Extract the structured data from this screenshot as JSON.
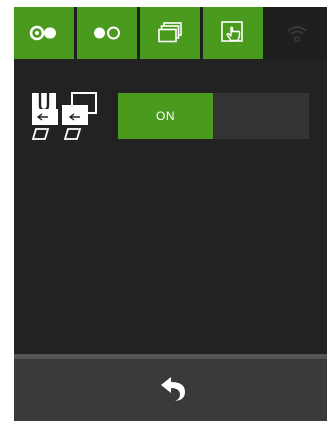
{
  "tabs": [
    {
      "name": "tab-tape-cassette",
      "icon": "tape-cassette-icon"
    },
    {
      "name": "tab-tape-reel",
      "icon": "tape-reel-icon"
    },
    {
      "name": "tab-copies",
      "icon": "copies-icon"
    },
    {
      "name": "tab-touch-panel",
      "icon": "touch-panel-icon"
    },
    {
      "name": "tab-wireless",
      "icon": "wifi-icon"
    }
  ],
  "setting": {
    "icon": "paper-feed-settings-icon",
    "toggle": {
      "on_label": "ON",
      "state": "on"
    }
  },
  "footer": {
    "back_icon": "back-arrow-icon"
  },
  "colors": {
    "accent": "#4a9a1e",
    "background": "#222222",
    "topbar": "#1f1f1f",
    "footer": "#3a3a3a",
    "toggle_off": "#333333"
  }
}
